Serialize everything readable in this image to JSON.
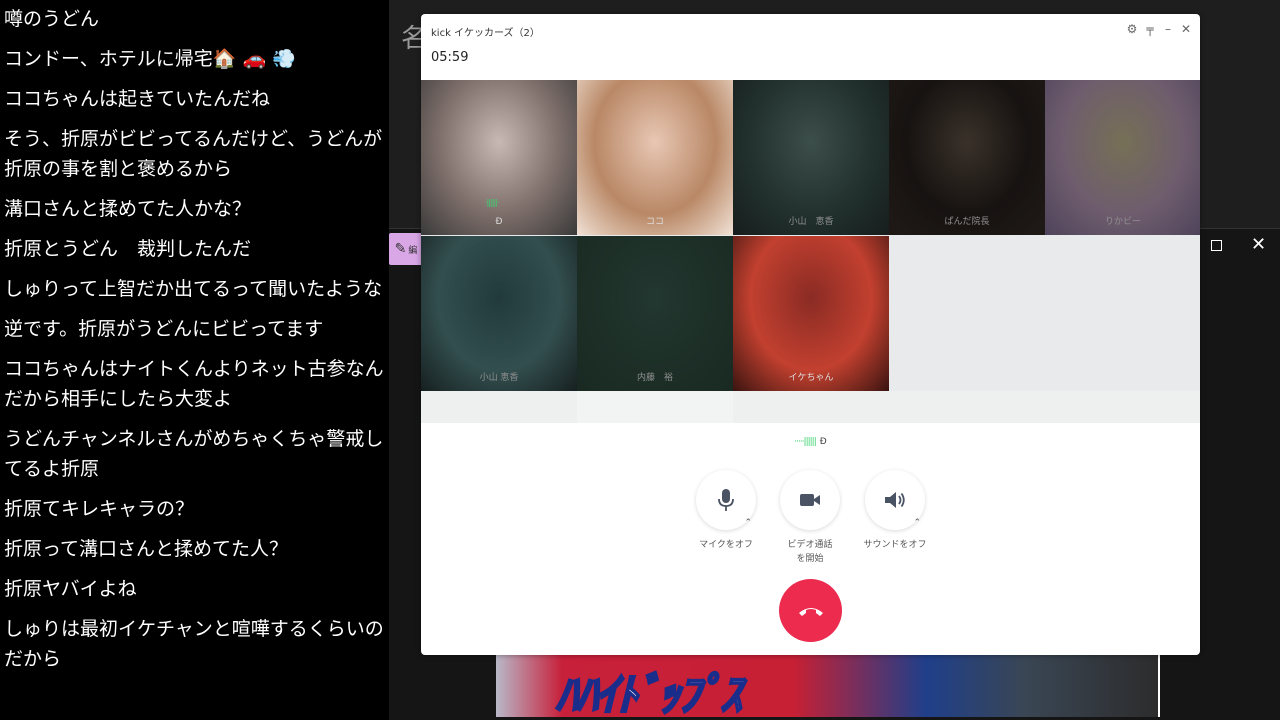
{
  "chat": {
    "messages": [
      "噂のうどん",
      "コンドー、ホテルに帰宅🏠 🚗 💨",
      "ココちゃんは起きていたんだね",
      "そう、折原がビビってるんだけど、うどんが折原の事を割と褒めるから",
      "溝口さんと揉めてた人かな？",
      "折原とうどん　裁判したんだ",
      "しゅりって上智だか出てるって聞いたような",
      "逆です。折原がうどんにビビってます",
      "ココちゃんはナイトくんよりネット古参なんだから相手にしたら大変よ",
      "うどんチャンネルさんがめちゃくちゃ警戒してるよ折原",
      "折原てキレキャラの？",
      "折原って溝口さんと揉めてた人？",
      "折原ヤバイよね",
      "しゅりは最初イケチャンと喧嘩するくらいのだから"
    ]
  },
  "background_app": {
    "title_char": "名",
    "edit_label": "編",
    "video_text": "ﾊﾊｲﾄﾞｯﾌﾟｽ"
  },
  "call": {
    "title": "kick イケッカーズ（2）",
    "timer": "05:59",
    "controls_header": [
      "⚙",
      "📌",
      "—",
      "✕"
    ],
    "participants": [
      {
        "name": "Ð",
        "colors": [
          "#c9b9b4",
          "#7d6e6a",
          "#3a3a3a"
        ],
        "speaking": true
      },
      {
        "name": "ココ",
        "colors": [
          "#e8c7b4",
          "#b98866",
          "#f1e2d6"
        ]
      },
      {
        "name": "小山　恵香",
        "colors": [
          "#6f8f88",
          "#3e5a55",
          "#2a3634"
        ],
        "dim": true
      },
      {
        "name": "ぱんだ院長",
        "colors": [
          "#6a5a4c",
          "#2a2320",
          "#3b302a"
        ],
        "dim": true
      },
      {
        "name": "りかビー",
        "colors": [
          "#d7cc9c",
          "#c9a9c7",
          "#8f7ba6"
        ],
        "dim": true
      },
      {
        "name": "小山 恵香",
        "colors": [
          "#3d6a6c",
          "#5d8f90",
          "#2a3a3a"
        ],
        "dim": true
      },
      {
        "name": "内藤　裕",
        "colors": [
          "#3f6659",
          "#355648",
          "#2f4c40"
        ],
        "dim": true
      },
      {
        "name": "イケちゃん",
        "colors": [
          "#8a2b24",
          "#c2402f",
          "#3a1410"
        ]
      }
    ],
    "active_speaker": "Ð",
    "buttons": {
      "mic": "マイクをオフ",
      "video": "ビデオ通話を開始",
      "sound": "サウンドをオフ"
    }
  }
}
